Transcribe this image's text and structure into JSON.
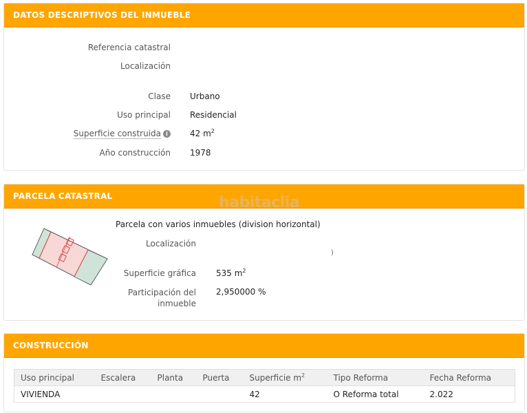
{
  "section1": {
    "title": "DATOS DESCRIPTIVOS DEL INMUEBLE",
    "rows": [
      {
        "label": "Referencia catastral",
        "value": ""
      },
      {
        "label": "Localización",
        "value": ""
      },
      {
        "label": "Clase",
        "value": "Urbano"
      },
      {
        "label": "Uso principal",
        "value": "Residencial"
      },
      {
        "label": "Superficie construida",
        "value": "42 m",
        "sup": "2"
      },
      {
        "label": "Año construcción",
        "value": "1978"
      }
    ]
  },
  "section2": {
    "title": "PARCELA CATASTRAL",
    "watermark": "habitaclia",
    "subtitle": "Parcela con varios inmuebles (division horizontal)",
    "rows": [
      {
        "label": "Localización",
        "value": ""
      },
      {
        "label": "Superficie gráfica",
        "value": "535 m",
        "sup": "2"
      },
      {
        "label_line1": "Participación del",
        "label_line2": "inmueble",
        "value": "2,950000 %"
      }
    ],
    "stray_mark": ")"
  },
  "section3": {
    "title": "CONSTRUCCIÓN",
    "columns": [
      "Uso principal",
      "Escalera",
      "Planta",
      "Puerta",
      "Superficie m",
      "Tipo Reforma",
      "Fecha Reforma"
    ],
    "superficie_sup": "2",
    "rows": [
      [
        "VIVIENDA",
        "",
        "",
        "",
        "42",
        "O Reforma total",
        "2.022"
      ]
    ]
  },
  "colors": {
    "header": "#ffa500",
    "parcel_pink": "#f8d7d7",
    "parcel_green": "#cfe3d9",
    "parcel_outline": "#d44"
  },
  "icons": {
    "info": "info-icon"
  }
}
